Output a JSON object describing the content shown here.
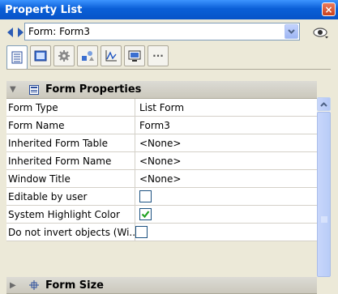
{
  "window": {
    "title": "Property List",
    "close_label": "×"
  },
  "selector": {
    "value": "Form: Form3"
  },
  "toolbar": {
    "tabs": [
      {
        "name": "properties-tab-icon",
        "active": true
      },
      {
        "name": "form-tab-icon",
        "active": false
      },
      {
        "name": "settings-tab-icon",
        "active": false
      },
      {
        "name": "objects-tab-icon",
        "active": false
      },
      {
        "name": "chart-tab-icon",
        "active": false
      },
      {
        "name": "display-tab-icon",
        "active": false
      },
      {
        "name": "more-tab-icon",
        "active": false,
        "label": "···"
      }
    ]
  },
  "sections": {
    "form_properties": "Form Properties",
    "form_size": "Form Size"
  },
  "rows": [
    {
      "name": "Form Type",
      "value": "List Form"
    },
    {
      "name": "Form Name",
      "value": "Form3"
    },
    {
      "name": "Inherited Form Table",
      "value": "<None>"
    },
    {
      "name": "Inherited Form Name",
      "value": "<None>"
    },
    {
      "name": "Window Title",
      "value": "<None>"
    },
    {
      "name": "Editable by user",
      "checkbox": false
    },
    {
      "name": "System Highlight Color",
      "checkbox": true
    },
    {
      "name": "Do not invert objects (Wi...",
      "checkbox": false
    }
  ],
  "colors": {
    "titlebar": "#0a5fd7",
    "check": "#21a121"
  }
}
